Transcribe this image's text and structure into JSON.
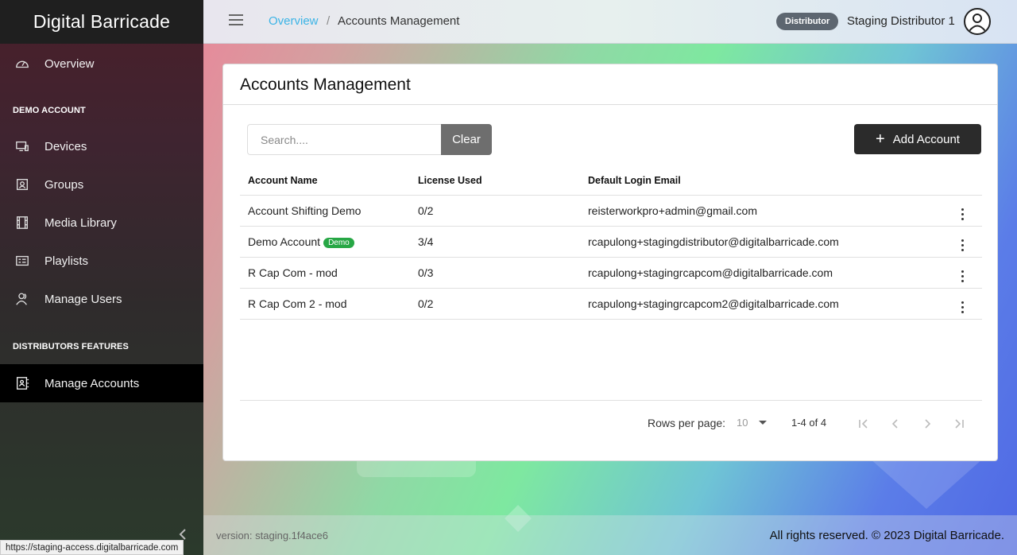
{
  "app": {
    "brand": "Digital Barricade"
  },
  "sidebar": {
    "items": [
      {
        "label": "Overview",
        "icon": "speedometer-icon"
      },
      {
        "label": "Devices",
        "icon": "monitor-icon"
      },
      {
        "label": "Groups",
        "icon": "group-icon"
      },
      {
        "label": "Media Library",
        "icon": "film-icon"
      },
      {
        "label": "Playlists",
        "icon": "playlist-icon"
      },
      {
        "label": "Manage Users",
        "icon": "users-icon"
      },
      {
        "label": "Manage Accounts",
        "icon": "accounts-icon"
      }
    ],
    "sections": [
      "DEMO ACCOUNT",
      "DISTRIBUTORS FEATURES"
    ],
    "collapse_icon": "chevron-left-icon"
  },
  "header": {
    "breadcrumb_link": "Overview",
    "breadcrumb_sep": "/",
    "breadcrumb_current": "Accounts Management",
    "role_badge": "Distributor",
    "user_name": "Staging Distributor 1"
  },
  "card": {
    "title": "Accounts Management",
    "search_placeholder": "Search....",
    "clear_label": "Clear",
    "add_label": "Add Account"
  },
  "table": {
    "columns": [
      "Account Name",
      "License Used",
      "Default Login Email"
    ],
    "rows": [
      {
        "name": "Account Shifting Demo",
        "badge": "",
        "license": "0/2",
        "email": "reisterworkpro+admin@gmail.com"
      },
      {
        "name": "Demo Account",
        "badge": "Demo",
        "license": "3/4",
        "email": "rcapulong+stagingdistributor@digitalbarricade.com"
      },
      {
        "name": "R Cap Com - mod",
        "badge": "",
        "license": "0/3",
        "email": "rcapulong+stagingrcapcom@digitalbarricade.com"
      },
      {
        "name": "R Cap Com 2 - mod",
        "badge": "",
        "license": "0/2",
        "email": "rcapulong+stagingrcapcom2@digitalbarricade.com"
      }
    ]
  },
  "pagination": {
    "rows_per_page_label": "Rows per page:",
    "rows_per_page_value": "10",
    "range": "1-4 of 4"
  },
  "footer": {
    "version": "version: staging.1f4ace6",
    "copyright": "All rights reserved. © 2023 Digital Barricade."
  },
  "status_url": "https://staging-access.digitalbarricade.com",
  "colors": {
    "accent_link": "#3cb4e6",
    "demo_badge": "#27a745",
    "active_nav": "#000000"
  }
}
